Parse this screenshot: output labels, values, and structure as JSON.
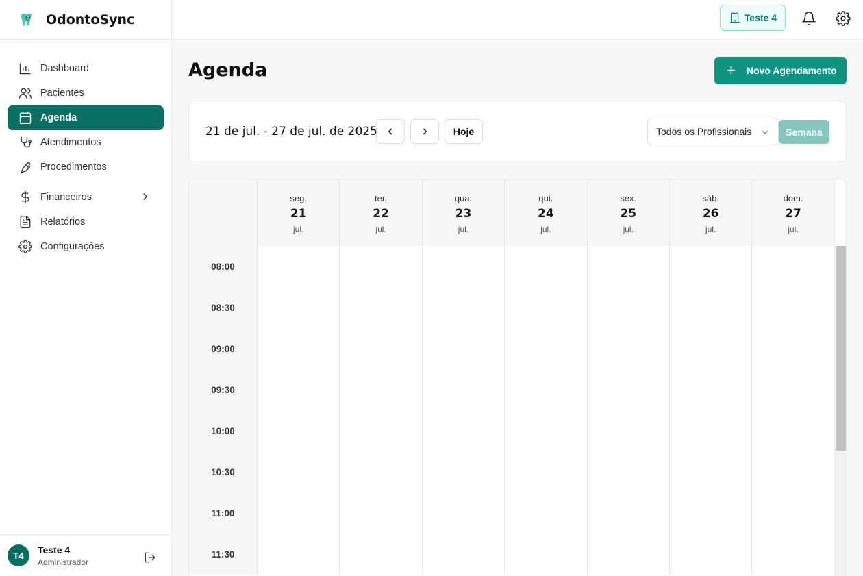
{
  "brand": {
    "name": "OdontoSync",
    "icon": "tooth-icon"
  },
  "sidebar": {
    "items": [
      {
        "label": "Dashboard",
        "icon": "bar-chart-icon"
      },
      {
        "label": "Pacientes",
        "icon": "users-icon"
      },
      {
        "label": "Agenda",
        "icon": "calendar-icon",
        "active": true
      },
      {
        "label": "Atendimentos",
        "icon": "stethoscope-icon"
      },
      {
        "label": "Procedimentos",
        "icon": "wrench-icon"
      },
      {
        "label": "Financeiros",
        "icon": "dollar-icon",
        "has_submenu": true
      },
      {
        "label": "Relatórios",
        "icon": "file-text-icon"
      },
      {
        "label": "Configurações",
        "icon": "gear-icon"
      }
    ]
  },
  "user": {
    "initials": "T4",
    "name": "Teste 4",
    "role": "Administrador"
  },
  "topbar": {
    "clinic": "Teste 4"
  },
  "page": {
    "title": "Agenda",
    "new_button": "Novo Agendamento"
  },
  "toolbar": {
    "range": "21 de jul. - 27 de jul. de 2025",
    "today": "Hoje",
    "professional_select": "Todos os Profissionais",
    "view": "Semana"
  },
  "calendar": {
    "days": [
      {
        "name": "seg.",
        "num": "21",
        "month": "jul."
      },
      {
        "name": "ter.",
        "num": "22",
        "month": "jul."
      },
      {
        "name": "qua.",
        "num": "23",
        "month": "jul."
      },
      {
        "name": "qui.",
        "num": "24",
        "month": "jul."
      },
      {
        "name": "sex.",
        "num": "25",
        "month": "jul."
      },
      {
        "name": "sáb.",
        "num": "26",
        "month": "jul."
      },
      {
        "name": "dom.",
        "num": "27",
        "month": "jul."
      }
    ],
    "times": [
      "08:00",
      "08:30",
      "09:00",
      "09:30",
      "10:00",
      "10:30",
      "11:00",
      "11:30"
    ]
  },
  "colors": {
    "primary": "#0b6e63",
    "button": "#0f9484",
    "week_button": "#85c7be"
  }
}
